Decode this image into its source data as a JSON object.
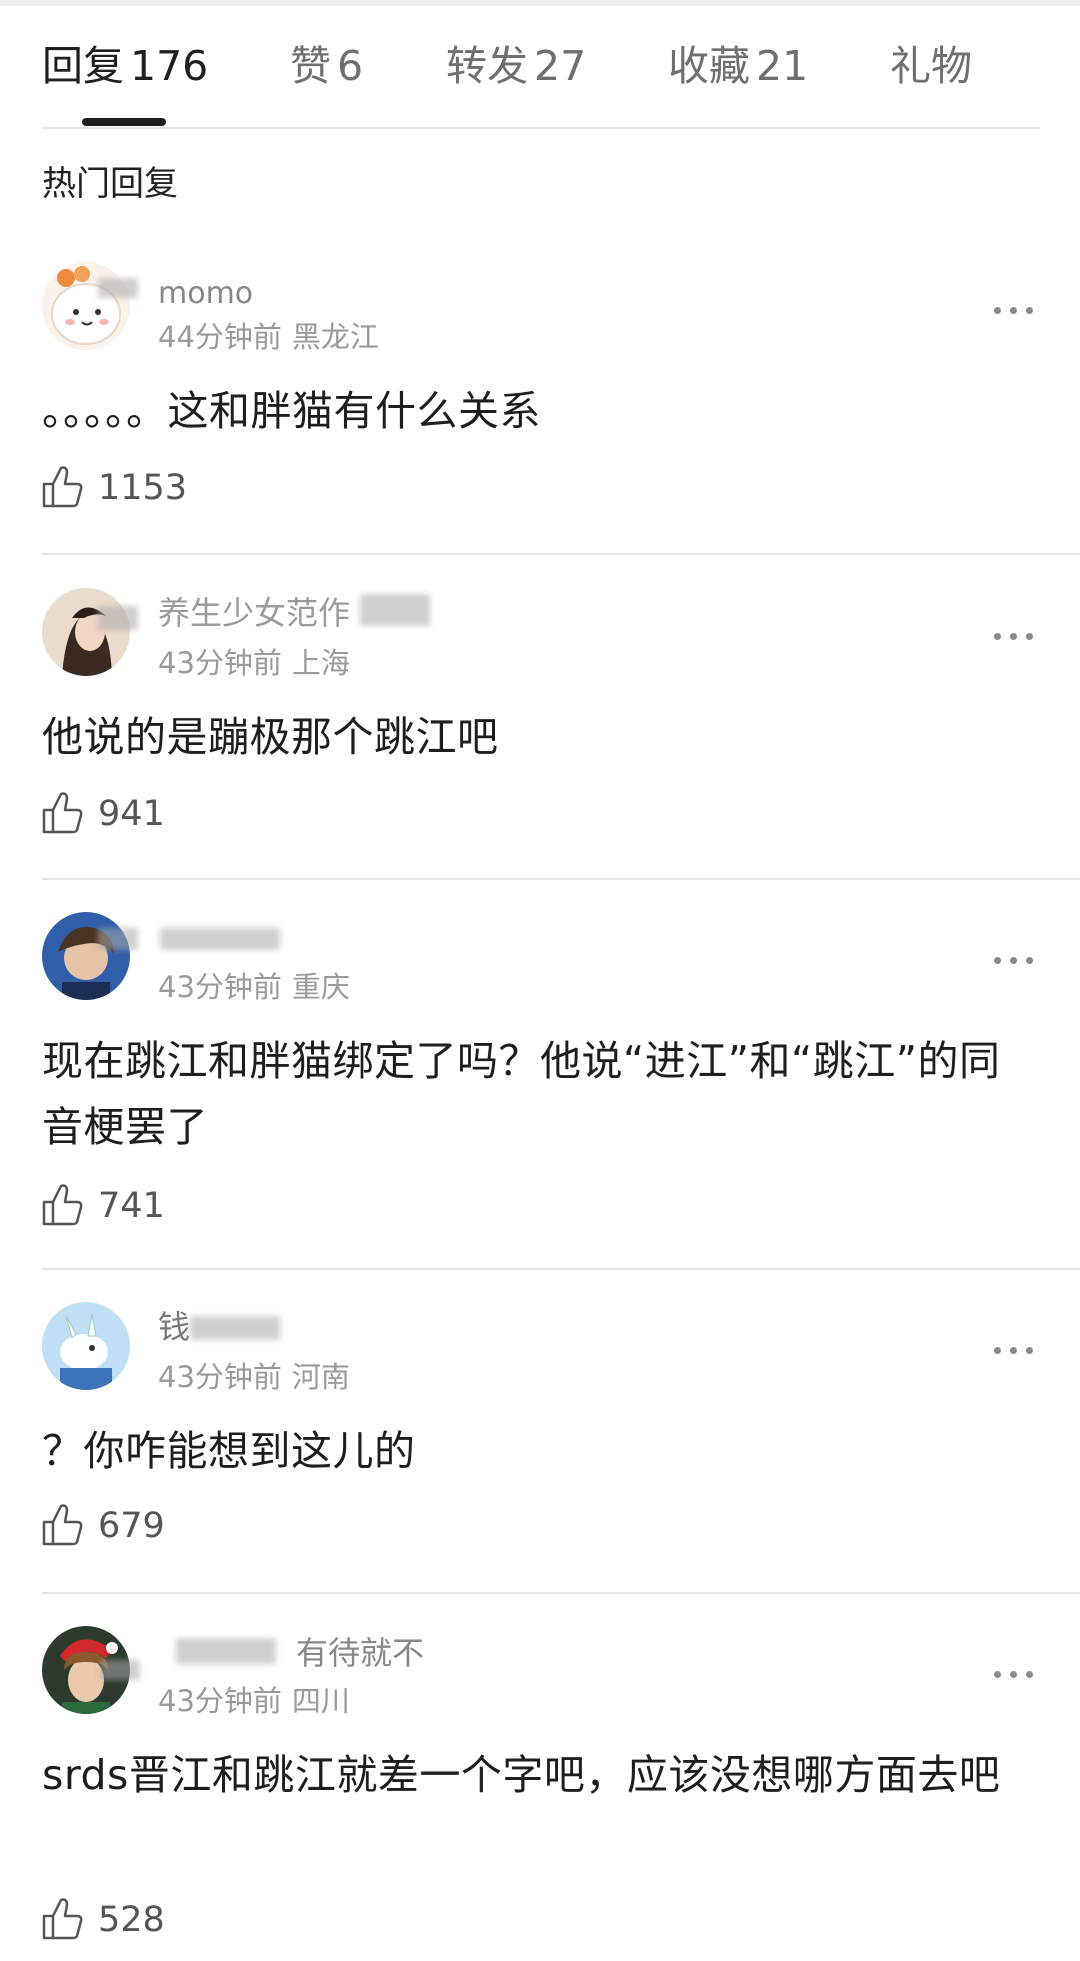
{
  "tabs": [
    {
      "label": "回复",
      "count": "176"
    },
    {
      "label": "赞",
      "count": "6"
    },
    {
      "label": "转发",
      "count": "27"
    },
    {
      "label": "收藏",
      "count": "21"
    },
    {
      "label": "礼物",
      "count": ""
    }
  ],
  "section_title": "热门回复",
  "comments": [
    {
      "username": "momo",
      "time": "44分钟前",
      "region": "黑龙江",
      "text": "。。。。。这和胖猫有什么关系",
      "likes": "1153"
    },
    {
      "username": "养生少女范作",
      "time": "43分钟前",
      "region": "上海",
      "text": "他说的是蹦极那个跳江吧",
      "likes": "941"
    },
    {
      "username": "",
      "time": "43分钟前",
      "region": "重庆",
      "text": "现在跳江和胖猫绑定了吗？他说“进江”和“跳江”的同音梗罢了",
      "likes": "741"
    },
    {
      "username": "钱",
      "time": "43分钟前",
      "region": "河南",
      "text": "？你咋能想到这儿的",
      "likes": "679"
    },
    {
      "username": "有待就不",
      "time": "43分钟前",
      "region": "四川",
      "text": "srds晋江和跳江就差一个字吧，应该没想哪方面去吧",
      "likes": "528"
    }
  ]
}
